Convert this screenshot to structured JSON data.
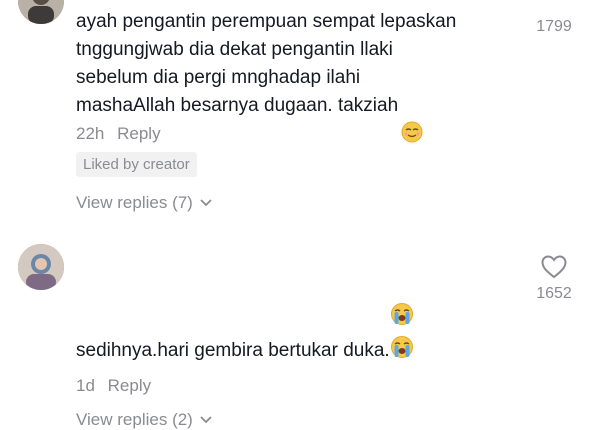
{
  "comments": [
    {
      "text": "ayah pengantin perempuan sempat lepaskan\ntnggungjwab dia dekat pengantin llaki\nsebelum dia pergi mnghadap ilahi\nmashaAllah besarnya dugaan. takziah",
      "time": "22h",
      "reply_label": "Reply",
      "liked_badge": "Liked by creator",
      "view_replies": "View replies (7)",
      "like_count": "1799",
      "emoji": "relieved-face"
    },
    {
      "text": "sedihnya.hari gembira bertukar duka.",
      "time": "1d",
      "reply_label": "Reply",
      "view_replies": "View replies (2)",
      "like_count": "1652",
      "emoji": "loudly-crying-face"
    }
  ],
  "colors": {
    "text": "#161823",
    "muted": "#8a8b91",
    "badge_bg": "#f1f1f2"
  }
}
